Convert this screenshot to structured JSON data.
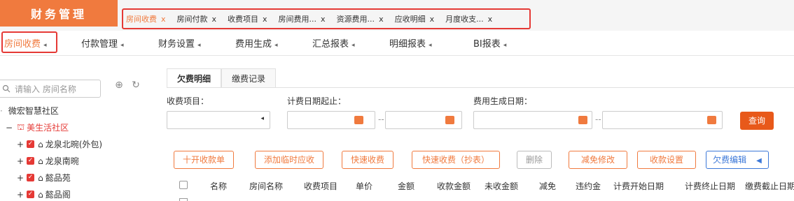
{
  "brand": {
    "title": "财务管理"
  },
  "open_tabs": [
    {
      "label": "房间收费",
      "close": "x",
      "active": true
    },
    {
      "label": "房间付款",
      "close": "x",
      "active": false
    },
    {
      "label": "收费项目",
      "close": "x",
      "active": false
    },
    {
      "label": "房间费用...",
      "close": "x",
      "active": false
    },
    {
      "label": "资源费用...",
      "close": "x",
      "active": false
    },
    {
      "label": "应收明细",
      "close": "x",
      "active": false
    },
    {
      "label": "月度收支...",
      "close": "x",
      "active": false
    }
  ],
  "menu": [
    {
      "label": "房间收费"
    },
    {
      "label": "付款管理"
    },
    {
      "label": "财务设置"
    },
    {
      "label": "费用生成"
    },
    {
      "label": "汇总报表"
    },
    {
      "label": "明细报表"
    },
    {
      "label": "BI报表"
    }
  ],
  "sidebar": {
    "search_placeholder": "请输入 房间名称",
    "tree": {
      "community": "微宏智慧社区",
      "sub": "美生活社区",
      "items": [
        "龙泉北晼(外包)",
        "龙泉南晼",
        "懿品苑",
        "懿品阁"
      ]
    }
  },
  "subtabs": [
    {
      "label": "欠费明细"
    },
    {
      "label": "缴费记录"
    }
  ],
  "filters": {
    "fee_item": "收费项目：",
    "bill_date": "计费日期起止：",
    "gen_date": "费用生成日期：",
    "query": "查询",
    "dash": "--"
  },
  "actions": [
    {
      "label": "十开收款单",
      "style": "orange"
    },
    {
      "label": "添加临时应收",
      "style": "orange"
    },
    {
      "label": "快速收费",
      "style": "orange"
    },
    {
      "label": "快速收费（抄表）",
      "style": "orange"
    },
    {
      "label": "删除",
      "style": "grey"
    },
    {
      "label": "减免修改",
      "style": "orange"
    },
    {
      "label": "收款设置",
      "style": "orange"
    },
    {
      "label": "欠费编辑",
      "style": "blue"
    }
  ],
  "table_headers": [
    "名称",
    "房间名称",
    "收费项目",
    "单价",
    "金额",
    "收款金额",
    "未收金额",
    "减免",
    "违约金",
    "计费开始日期",
    "计费终止日期",
    "缴费截止日期"
  ]
}
